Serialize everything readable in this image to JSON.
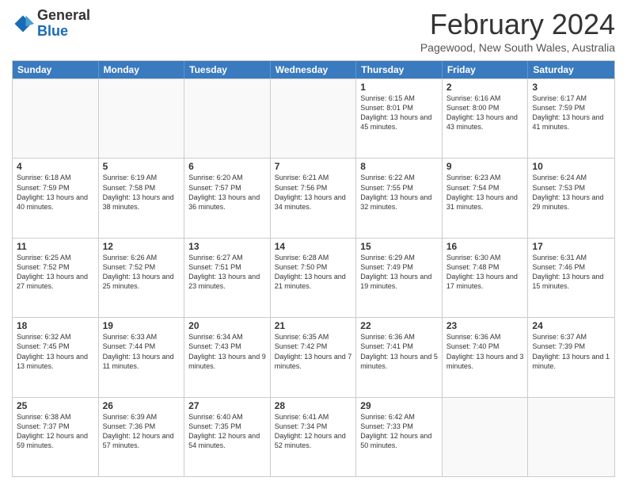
{
  "logo": {
    "general": "General",
    "blue": "Blue"
  },
  "header": {
    "month": "February 2024",
    "location": "Pagewood, New South Wales, Australia"
  },
  "weekdays": [
    "Sunday",
    "Monday",
    "Tuesday",
    "Wednesday",
    "Thursday",
    "Friday",
    "Saturday"
  ],
  "rows": [
    [
      {
        "day": "",
        "text": ""
      },
      {
        "day": "",
        "text": ""
      },
      {
        "day": "",
        "text": ""
      },
      {
        "day": "",
        "text": ""
      },
      {
        "day": "1",
        "text": "Sunrise: 6:15 AM\nSunset: 8:01 PM\nDaylight: 13 hours and 45 minutes."
      },
      {
        "day": "2",
        "text": "Sunrise: 6:16 AM\nSunset: 8:00 PM\nDaylight: 13 hours and 43 minutes."
      },
      {
        "day": "3",
        "text": "Sunrise: 6:17 AM\nSunset: 7:59 PM\nDaylight: 13 hours and 41 minutes."
      }
    ],
    [
      {
        "day": "4",
        "text": "Sunrise: 6:18 AM\nSunset: 7:59 PM\nDaylight: 13 hours and 40 minutes."
      },
      {
        "day": "5",
        "text": "Sunrise: 6:19 AM\nSunset: 7:58 PM\nDaylight: 13 hours and 38 minutes."
      },
      {
        "day": "6",
        "text": "Sunrise: 6:20 AM\nSunset: 7:57 PM\nDaylight: 13 hours and 36 minutes."
      },
      {
        "day": "7",
        "text": "Sunrise: 6:21 AM\nSunset: 7:56 PM\nDaylight: 13 hours and 34 minutes."
      },
      {
        "day": "8",
        "text": "Sunrise: 6:22 AM\nSunset: 7:55 PM\nDaylight: 13 hours and 32 minutes."
      },
      {
        "day": "9",
        "text": "Sunrise: 6:23 AM\nSunset: 7:54 PM\nDaylight: 13 hours and 31 minutes."
      },
      {
        "day": "10",
        "text": "Sunrise: 6:24 AM\nSunset: 7:53 PM\nDaylight: 13 hours and 29 minutes."
      }
    ],
    [
      {
        "day": "11",
        "text": "Sunrise: 6:25 AM\nSunset: 7:52 PM\nDaylight: 13 hours and 27 minutes."
      },
      {
        "day": "12",
        "text": "Sunrise: 6:26 AM\nSunset: 7:52 PM\nDaylight: 13 hours and 25 minutes."
      },
      {
        "day": "13",
        "text": "Sunrise: 6:27 AM\nSunset: 7:51 PM\nDaylight: 13 hours and 23 minutes."
      },
      {
        "day": "14",
        "text": "Sunrise: 6:28 AM\nSunset: 7:50 PM\nDaylight: 13 hours and 21 minutes."
      },
      {
        "day": "15",
        "text": "Sunrise: 6:29 AM\nSunset: 7:49 PM\nDaylight: 13 hours and 19 minutes."
      },
      {
        "day": "16",
        "text": "Sunrise: 6:30 AM\nSunset: 7:48 PM\nDaylight: 13 hours and 17 minutes."
      },
      {
        "day": "17",
        "text": "Sunrise: 6:31 AM\nSunset: 7:46 PM\nDaylight: 13 hours and 15 minutes."
      }
    ],
    [
      {
        "day": "18",
        "text": "Sunrise: 6:32 AM\nSunset: 7:45 PM\nDaylight: 13 hours and 13 minutes."
      },
      {
        "day": "19",
        "text": "Sunrise: 6:33 AM\nSunset: 7:44 PM\nDaylight: 13 hours and 11 minutes."
      },
      {
        "day": "20",
        "text": "Sunrise: 6:34 AM\nSunset: 7:43 PM\nDaylight: 13 hours and 9 minutes."
      },
      {
        "day": "21",
        "text": "Sunrise: 6:35 AM\nSunset: 7:42 PM\nDaylight: 13 hours and 7 minutes."
      },
      {
        "day": "22",
        "text": "Sunrise: 6:36 AM\nSunset: 7:41 PM\nDaylight: 13 hours and 5 minutes."
      },
      {
        "day": "23",
        "text": "Sunrise: 6:36 AM\nSunset: 7:40 PM\nDaylight: 13 hours and 3 minutes."
      },
      {
        "day": "24",
        "text": "Sunrise: 6:37 AM\nSunset: 7:39 PM\nDaylight: 13 hours and 1 minute."
      }
    ],
    [
      {
        "day": "25",
        "text": "Sunrise: 6:38 AM\nSunset: 7:37 PM\nDaylight: 12 hours and 59 minutes."
      },
      {
        "day": "26",
        "text": "Sunrise: 6:39 AM\nSunset: 7:36 PM\nDaylight: 12 hours and 57 minutes."
      },
      {
        "day": "27",
        "text": "Sunrise: 6:40 AM\nSunset: 7:35 PM\nDaylight: 12 hours and 54 minutes."
      },
      {
        "day": "28",
        "text": "Sunrise: 6:41 AM\nSunset: 7:34 PM\nDaylight: 12 hours and 52 minutes."
      },
      {
        "day": "29",
        "text": "Sunrise: 6:42 AM\nSunset: 7:33 PM\nDaylight: 12 hours and 50 minutes."
      },
      {
        "day": "",
        "text": ""
      },
      {
        "day": "",
        "text": ""
      }
    ]
  ]
}
